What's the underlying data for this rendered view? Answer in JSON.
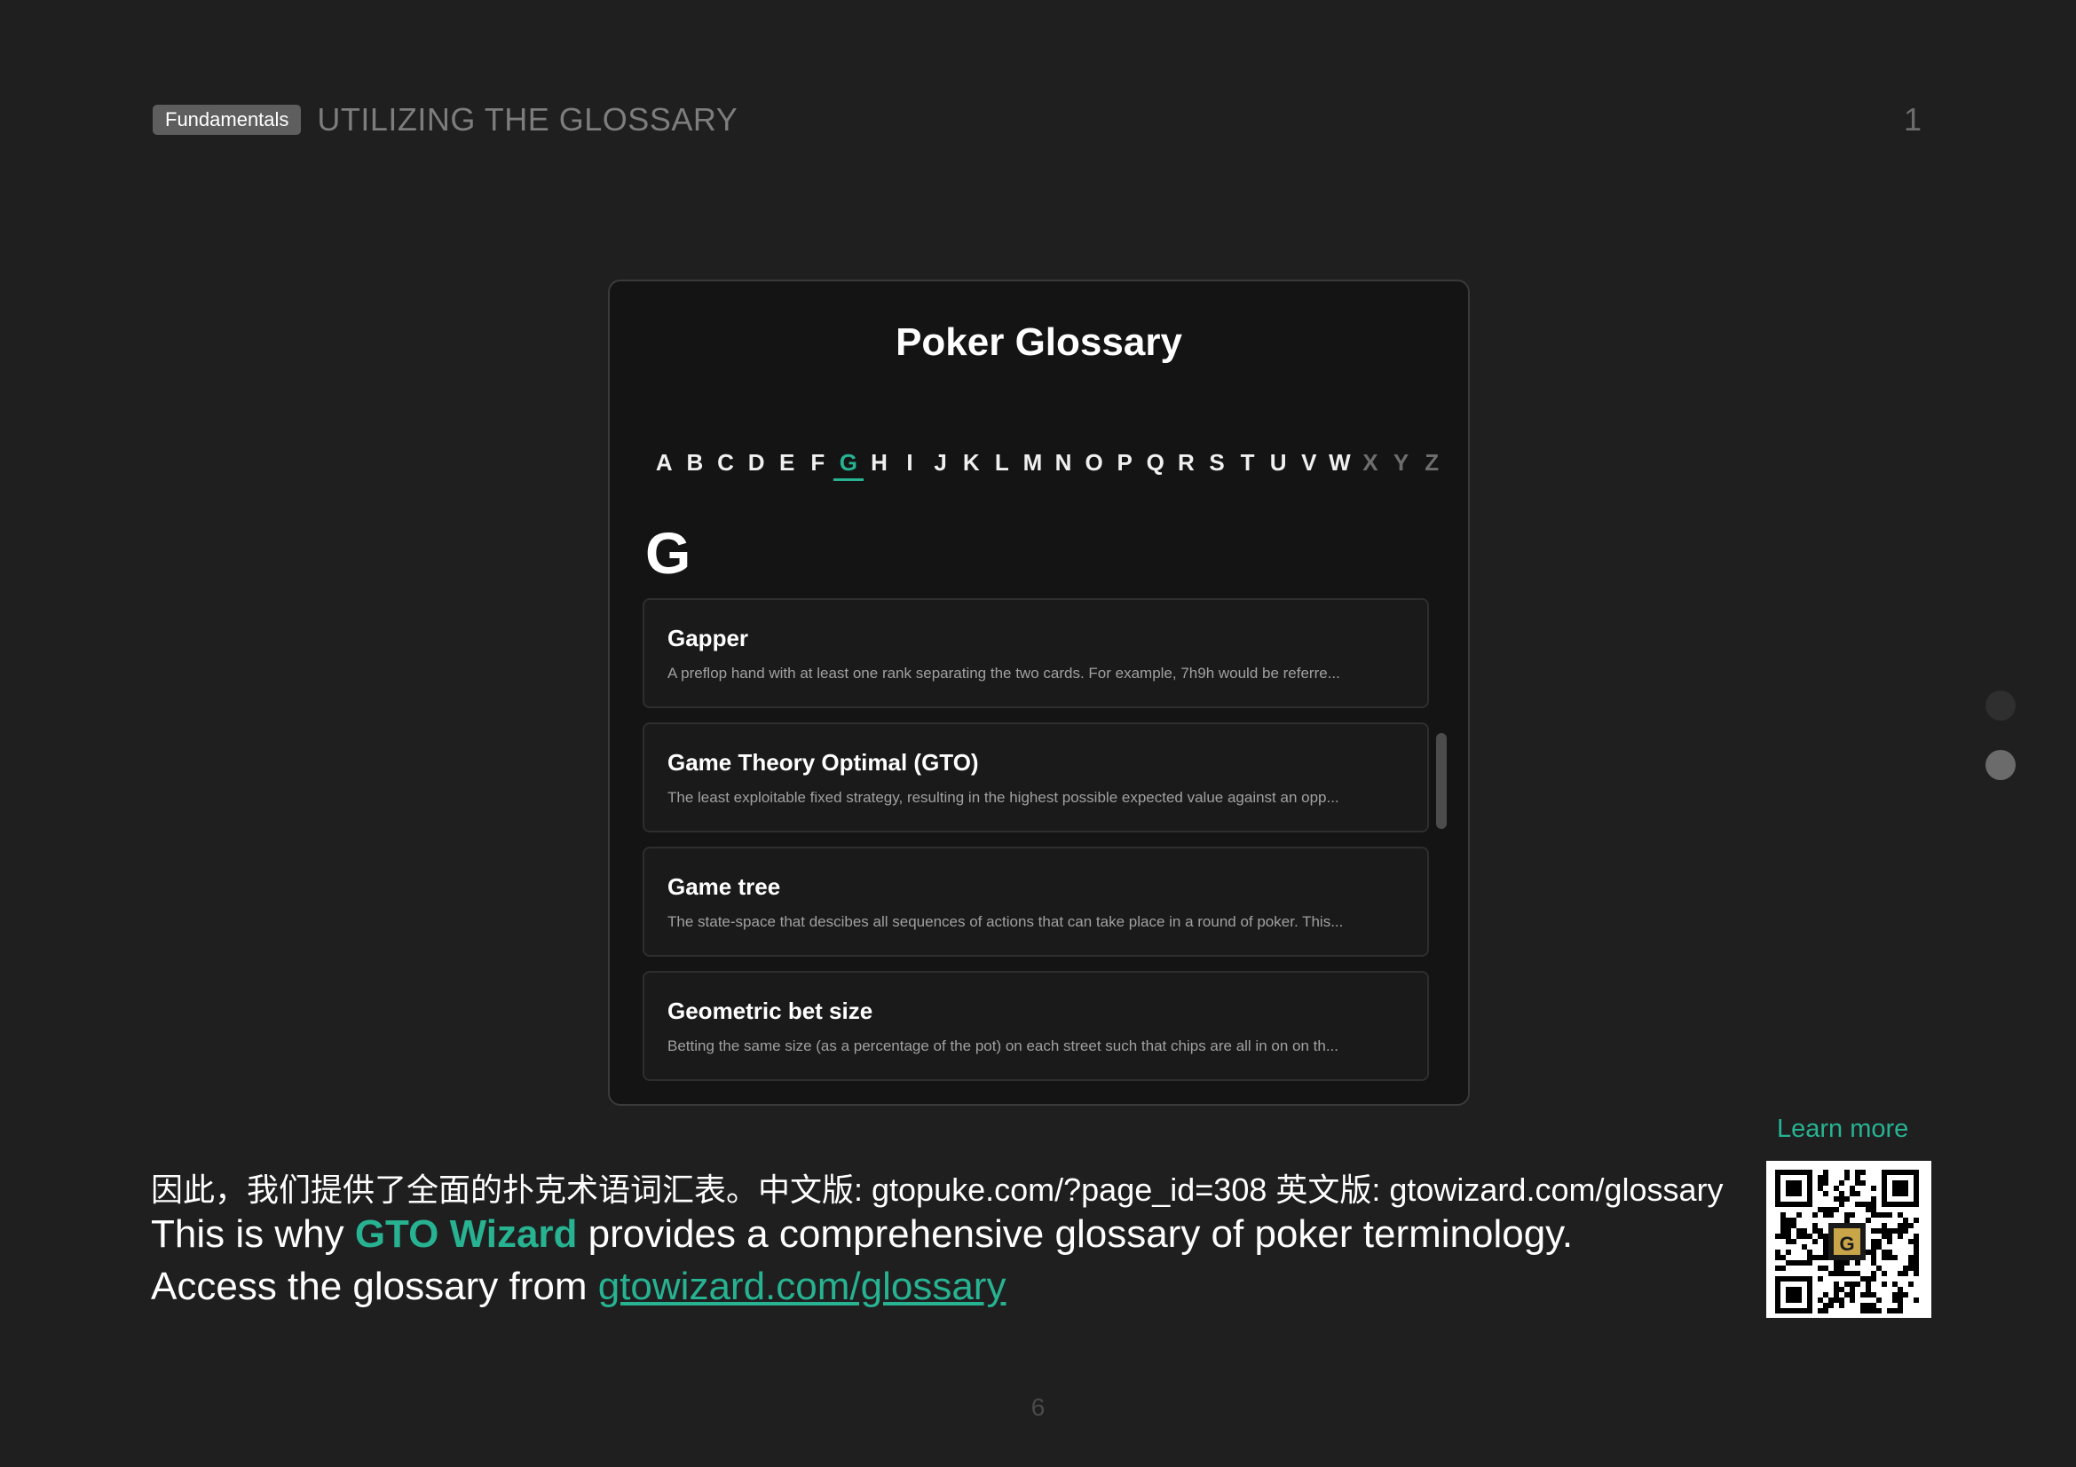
{
  "header": {
    "badge": "Fundamentals",
    "title": "UTILIZING THE GLOSSARY",
    "page_number": "1"
  },
  "glossary": {
    "title": "Poker Glossary",
    "alphabet": [
      "A",
      "B",
      "C",
      "D",
      "E",
      "F",
      "G",
      "H",
      "I",
      "J",
      "K",
      "L",
      "M",
      "N",
      "O",
      "P",
      "Q",
      "R",
      "S",
      "T",
      "U",
      "V",
      "W",
      "X",
      "Y",
      "Z"
    ],
    "active_letter": "G",
    "dim_letters": [
      "X",
      "Y",
      "Z"
    ],
    "section_letter": "G",
    "entries": [
      {
        "title": "Gapper",
        "desc": "A preflop hand with at least one rank separating the two cards. For example, 7h9h would be referre..."
      },
      {
        "title": "Game Theory Optimal (GTO)",
        "desc": "The least exploitable fixed strategy, resulting in the highest possible expected value against an opp..."
      },
      {
        "title": "Game tree",
        "desc": "The state-space that descibes all sequences of actions that can take place in a round of poker. This..."
      },
      {
        "title": "Geometric bet size",
        "desc": "Betting the same size (as a percentage of the pot) on each street such that chips are all in on on th..."
      }
    ]
  },
  "bottom": {
    "cn_line": "因此，我们提供了全面的扑克术语词汇表。中文版: gtopuke.com/?page_id=308  英文版: gtowizard.com/glossary",
    "en_line1_pre": "This is why ",
    "en_line1_brand": "GTO Wizard",
    "en_line1_post": " provides a comprehensive glossary of poker terminology.",
    "en_line2_pre": "Access the glossary from ",
    "en_line2_link": "gtowizard.com/glossary",
    "learn_more": "Learn more"
  },
  "footer_page": "6",
  "colors": {
    "background": "#1f1f20",
    "accent": "#27b391",
    "card": "#141415"
  }
}
